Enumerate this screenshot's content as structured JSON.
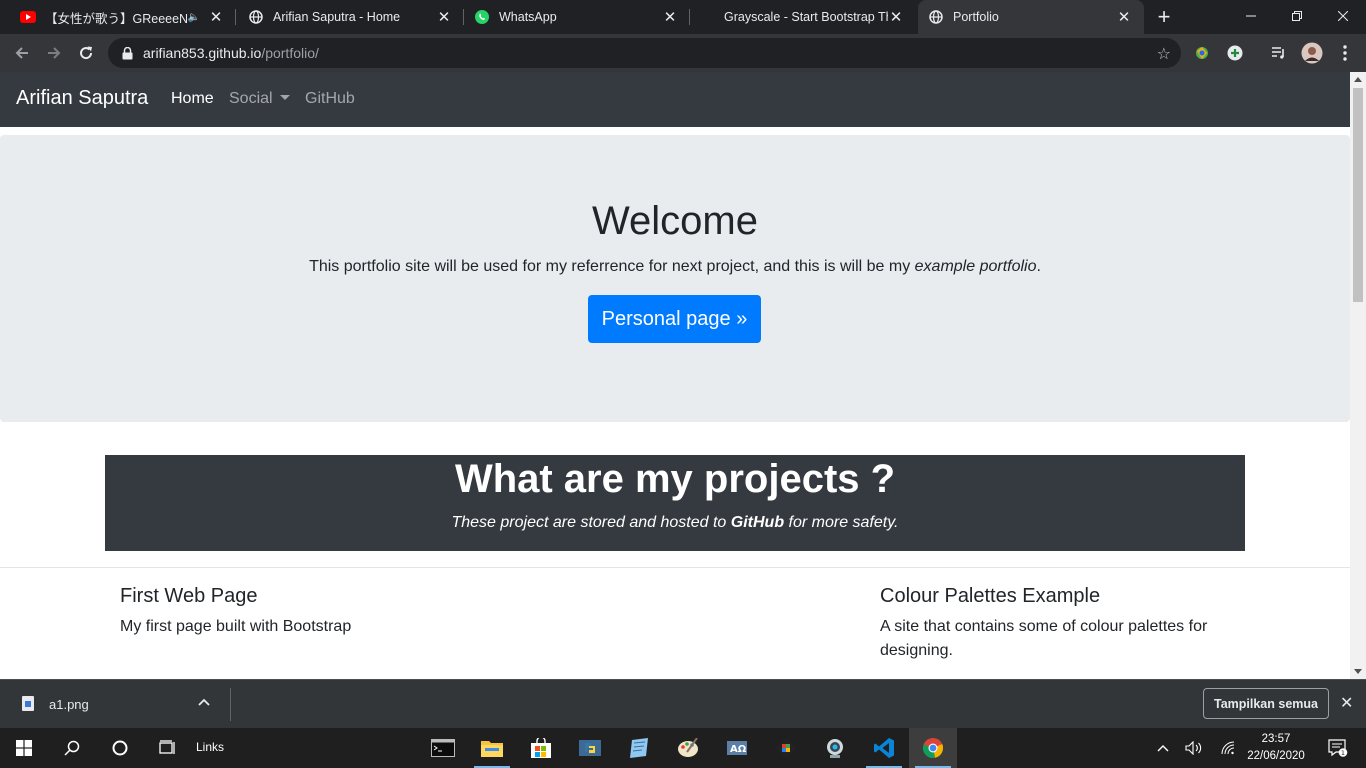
{
  "browser": {
    "tabs": [
      {
        "title": "【女性が歌う】GReeeeN / 星",
        "favicon": "youtube-icon",
        "audio": true
      },
      {
        "title": "Arifian Saputra - Home",
        "favicon": "globe-icon"
      },
      {
        "title": "WhatsApp",
        "favicon": "whatsapp-icon"
      },
      {
        "title": "Grayscale - Start Bootstrap The",
        "favicon": "none"
      },
      {
        "title": "Portfolio",
        "favicon": "globe-icon",
        "active": true
      }
    ],
    "new_tab_label": "+",
    "url_host": "arifian853.github.io",
    "url_path": "/portfolio/"
  },
  "site": {
    "brand": "Arifian Saputra",
    "nav": {
      "home": "Home",
      "social": "Social",
      "github": "GitHub"
    },
    "jumbotron": {
      "heading": "Welcome",
      "text_before": "This portfolio site will be used for my referrence for next project, and this is will be my ",
      "text_em": "example portfolio",
      "text_after": ".",
      "button": "Personal page »"
    },
    "projects_banner": {
      "heading": "What are my projects ?",
      "sub_before": "These project are stored and hosted to ",
      "sub_bold": "GitHub",
      "sub_after": " for more safety."
    },
    "cards": [
      {
        "title": "First Web Page",
        "text": "My first page built with Bootstrap"
      },
      {
        "title": "Colour Palettes Example",
        "text": "A site that contains some of colour palettes for designing."
      }
    ]
  },
  "downloads": {
    "file": "a1.png",
    "show_all": "Tampilkan semua"
  },
  "taskbar": {
    "links": "Links",
    "time": "23:57",
    "date": "22/06/2020",
    "notifications": "1"
  },
  "colors": {
    "primary": "#007bff",
    "dark": "#343a40",
    "jumbotron": "#e9ecef"
  }
}
